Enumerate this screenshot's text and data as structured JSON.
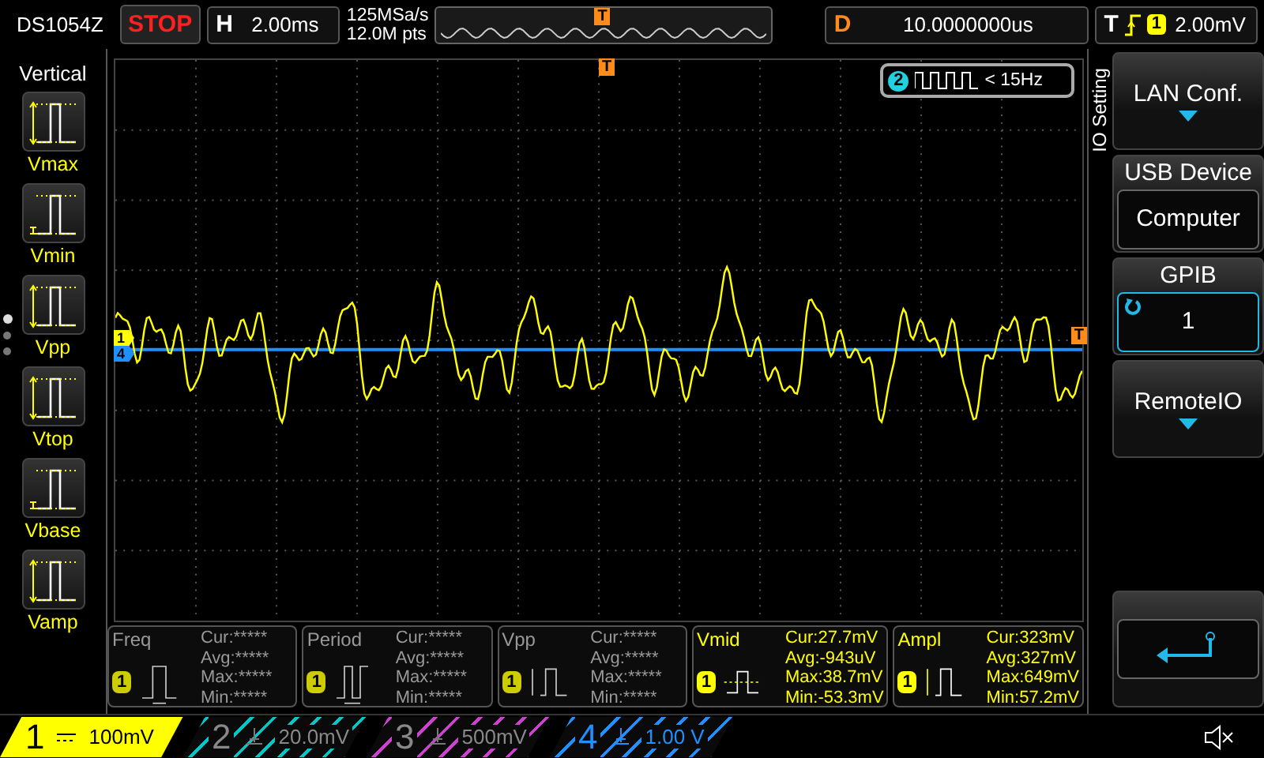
{
  "model": "DS1054Z",
  "run_state": "STOP",
  "horizontal": {
    "label": "H",
    "timebase": "2.00ms",
    "sample_rate": "125MSa/s",
    "memory_depth": "12.0M pts",
    "marker": "T"
  },
  "delay": {
    "label": "D",
    "value": "10.0000000us"
  },
  "trigger": {
    "label": "T",
    "channel": "1",
    "level": "2.00mV"
  },
  "left_menu": {
    "title": "Vertical",
    "items": [
      {
        "label": "Vmax",
        "kind": "max"
      },
      {
        "label": "Vmin",
        "kind": "min"
      },
      {
        "label": "Vpp",
        "kind": "pp"
      },
      {
        "label": "Vtop",
        "kind": "top"
      },
      {
        "label": "Vbase",
        "kind": "base"
      },
      {
        "label": "Vamp",
        "kind": "amp"
      }
    ],
    "pages": [
      {
        "selected": true
      },
      {
        "selected": false
      },
      {
        "selected": false
      }
    ]
  },
  "plot": {
    "trigger_marker": "T",
    "level_marker": "T",
    "channel_markers": [
      {
        "label": "1",
        "color": "#ffff00"
      },
      {
        "label": "4",
        "color": "#1e90ff"
      }
    ],
    "frequency_counter": {
      "channel": "2",
      "reading": "< 15Hz"
    }
  },
  "right_menu": {
    "title": "IO Setting",
    "items": [
      {
        "kind": "dropdown",
        "label": "LAN Conf."
      },
      {
        "kind": "value",
        "label": "USB Device",
        "value": "Computer"
      },
      {
        "kind": "knob",
        "label": "GPIB",
        "value": "1"
      },
      {
        "kind": "dropdown",
        "label": "RemoteIO"
      },
      {
        "kind": "back"
      }
    ]
  },
  "measurements": [
    {
      "name": "Freq",
      "channel": "1",
      "kind": "freq",
      "valid": false,
      "lines": [
        "Cur:*****",
        "Avg:*****",
        "Max:*****",
        "Min:*****"
      ]
    },
    {
      "name": "Period",
      "channel": "1",
      "kind": "period",
      "valid": false,
      "lines": [
        "Cur:*****",
        "Avg:*****",
        "Max:*****",
        "Min:*****"
      ]
    },
    {
      "name": "Vpp",
      "channel": "1",
      "kind": "pp",
      "valid": false,
      "lines": [
        "Cur:*****",
        "Avg:*****",
        "Max:*****",
        "Min:*****"
      ]
    },
    {
      "name": "Vmid",
      "channel": "1",
      "kind": "mid",
      "valid": true,
      "lines": [
        "Cur:27.7mV",
        "Avg:-943uV",
        "Max:38.7mV",
        "Min:-53.3mV"
      ]
    },
    {
      "name": "Ampl",
      "channel": "1",
      "kind": "amp",
      "valid": true,
      "lines": [
        "Cur:323mV",
        "Avg:327mV",
        "Max:649mV",
        "Min:57.2mV"
      ]
    }
  ],
  "channels": [
    {
      "label": "1",
      "kind": "dc",
      "scale": "100mV",
      "enabled": true,
      "selected": true,
      "color": "#ffff00"
    },
    {
      "label": "2",
      "kind": "gnd",
      "scale": "20.0mV",
      "enabled": false,
      "selected": false,
      "color": "#00c8c8"
    },
    {
      "label": "3",
      "kind": "gnd",
      "scale": "500mV",
      "enabled": false,
      "selected": false,
      "color": "#d040d0"
    },
    {
      "label": "4",
      "kind": "gnd",
      "scale": "1.00 V",
      "enabled": true,
      "selected": false,
      "color": "#1e90ff"
    }
  ]
}
